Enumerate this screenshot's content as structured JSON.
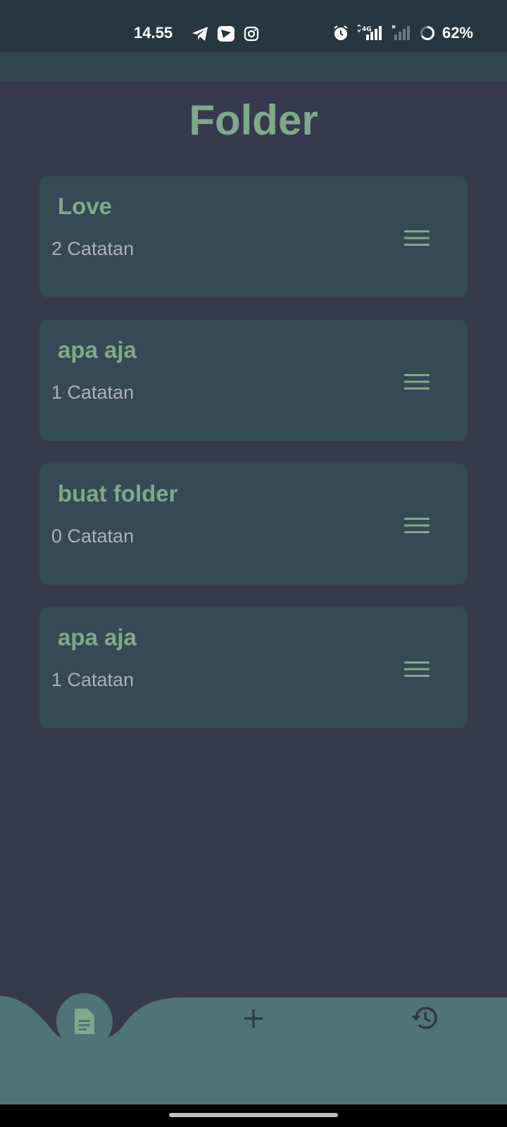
{
  "status_bar": {
    "time": "14.55",
    "battery": "62%",
    "network": "4G",
    "left_icons": [
      "telegram-icon",
      "video-app-icon",
      "instagram-icon"
    ],
    "right_icons": [
      "alarm-icon",
      "signal-4g-icon",
      "signal-no-service-icon",
      "battery-icon"
    ]
  },
  "page": {
    "title": "Folder"
  },
  "folders": [
    {
      "name": "Love",
      "count": "2 Catatan"
    },
    {
      "name": "apa aja",
      "count": "1 Catatan"
    },
    {
      "name": "buat folder",
      "count": "0 Catatan"
    },
    {
      "name": "apa aja",
      "count": "1 Catatan"
    }
  ],
  "bottom_nav": {
    "items": [
      {
        "icon": "note-icon",
        "active": true
      },
      {
        "icon": "plus-icon",
        "active": false
      },
      {
        "icon": "history-icon",
        "active": false
      }
    ]
  },
  "colors": {
    "background": "#363a4f",
    "status_bar": "#263741",
    "app_bar": "#334855",
    "card": "#344a57",
    "accent": "#7fa98a",
    "nav_bar": "#4f727b",
    "muted_text": "#a9b0b8"
  }
}
